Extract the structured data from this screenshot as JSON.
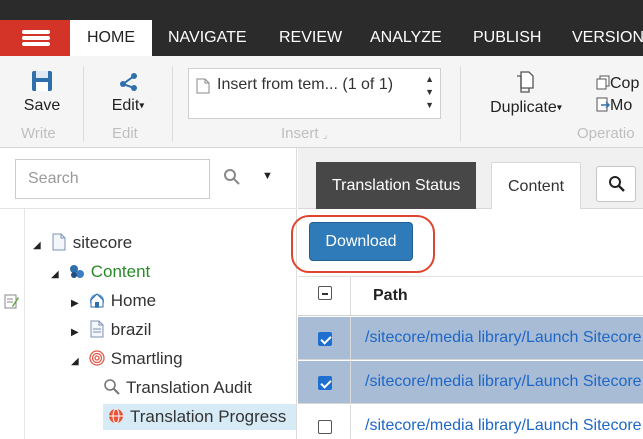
{
  "nav": {
    "tabs": [
      {
        "label": "HOME",
        "active": true
      },
      {
        "label": "NAVIGATE",
        "active": false
      },
      {
        "label": "REVIEW",
        "active": false
      },
      {
        "label": "ANALYZE",
        "active": false
      },
      {
        "label": "PUBLISH",
        "active": false
      },
      {
        "label": "VERSION",
        "active": false
      }
    ]
  },
  "ribbon": {
    "write": {
      "button": "Save",
      "label": "Write"
    },
    "edit": {
      "button": "Edit",
      "label": "Edit"
    },
    "insert": {
      "option": "Insert from tem... (1 of 1)",
      "label": "Insert"
    },
    "operations": {
      "button": "Duplicate",
      "copy": "Cop",
      "move": "Mo",
      "label": "Operatio"
    }
  },
  "left_pane": {
    "search": {
      "placeholder": "Search",
      "value": ""
    },
    "tree": [
      {
        "label": "sitecore",
        "icon": "page-icon"
      },
      {
        "label": "Content",
        "icon": "content-icon",
        "color": "#2a8a2a"
      },
      {
        "label": "Home",
        "icon": "home-icon"
      },
      {
        "label": "brazil",
        "icon": "page-icon"
      },
      {
        "label": "Smartling",
        "icon": "fingerprint-icon"
      },
      {
        "label": "Translation Audit",
        "icon": "magnifier-icon"
      },
      {
        "label": "Translation Progress",
        "icon": "globe-icon",
        "selected": true
      }
    ]
  },
  "right_pane": {
    "tabs": [
      {
        "label": "Translation Status",
        "active": true
      },
      {
        "label": "Content",
        "active": false
      }
    ],
    "download_label": "Download",
    "grid": {
      "header": "Path",
      "rows": [
        {
          "path": "/sitecore/media library/Launch Sitecore",
          "checked": true
        },
        {
          "path": "/sitecore/media library/Launch Sitecore",
          "checked": true
        },
        {
          "path": "/sitecore/media library/Launch Sitecore",
          "checked": false
        }
      ]
    }
  },
  "colors": {
    "nav_bg": "#2b2b2b",
    "hamburger_red": "#d33427",
    "button_blue": "#2f7ab8",
    "link_blue": "#1e67c6",
    "selected_row": "#a9bcd6",
    "highlight_ring": "#e0442e"
  }
}
